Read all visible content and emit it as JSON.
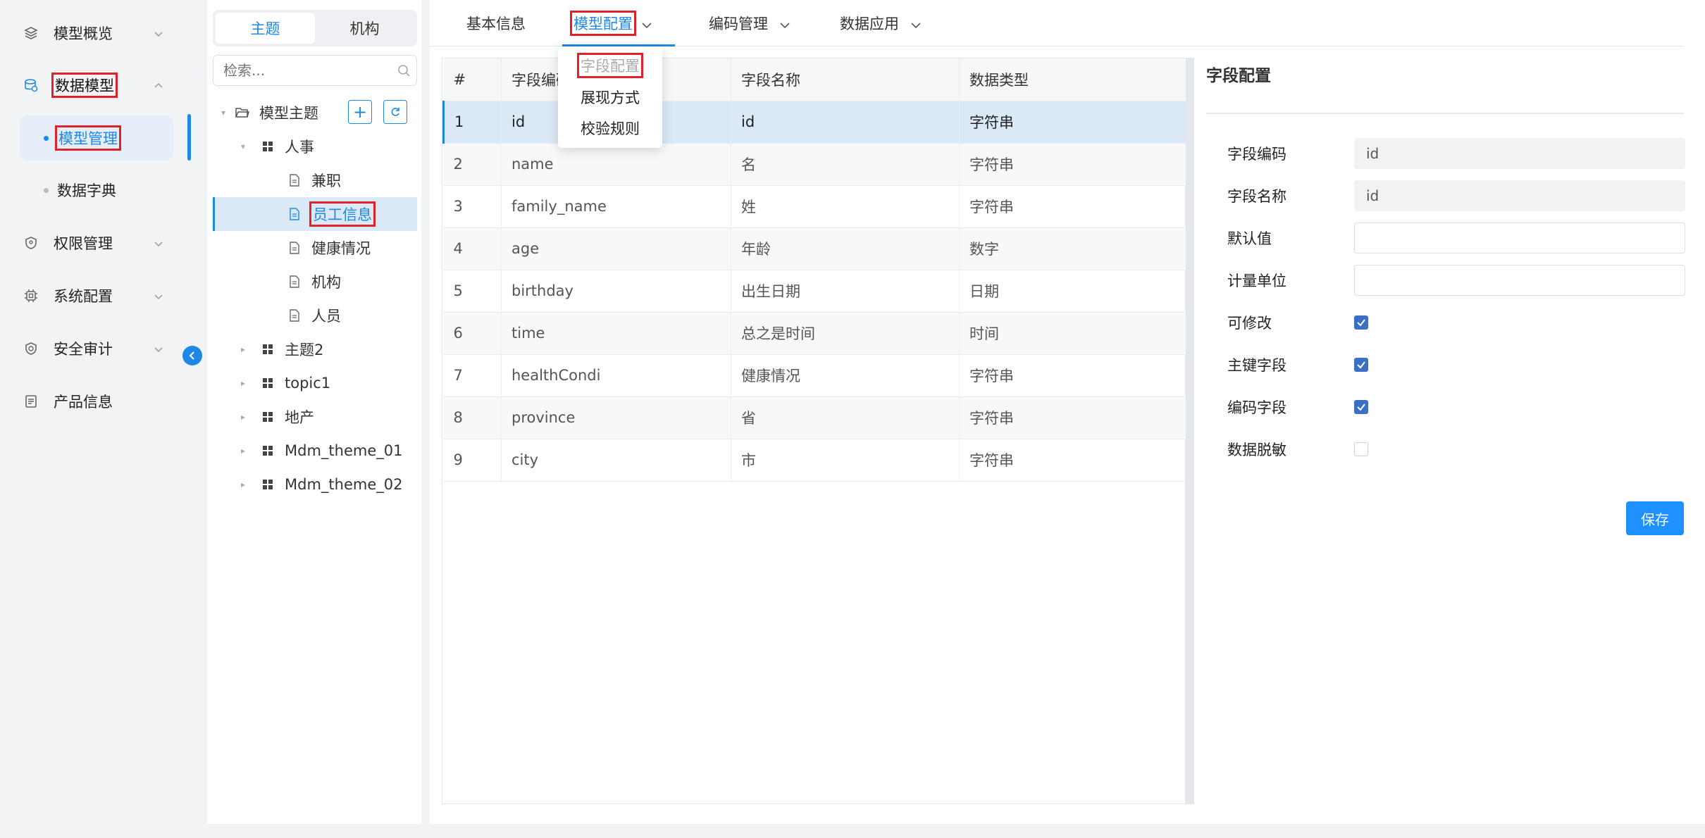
{
  "nav": {
    "items": [
      {
        "label": "模型概览",
        "icon": "layers-icon"
      },
      {
        "label": "数据模型",
        "icon": "database-icon"
      },
      {
        "label": "权限管理",
        "icon": "shield-icon"
      },
      {
        "label": "系统配置",
        "icon": "chip-icon"
      },
      {
        "label": "安全审计",
        "icon": "audit-shield-icon"
      },
      {
        "label": "产品信息",
        "icon": "document-list-icon"
      }
    ],
    "sub": [
      {
        "label": "模型管理"
      },
      {
        "label": "数据字典"
      }
    ]
  },
  "tree": {
    "segments": [
      "主题",
      "机构"
    ],
    "search_placeholder": "检索...",
    "root": "模型主题",
    "nodes": [
      "人事",
      "兼职",
      "员工信息",
      "健康情况",
      "机构",
      "人员",
      "主题2",
      "topic1",
      "地产",
      "Mdm_theme_01",
      "Mdm_theme_02"
    ]
  },
  "tabs": [
    "基本信息",
    "模型配置",
    "编码管理",
    "数据应用"
  ],
  "dropdown": [
    "字段配置",
    "展现方式",
    "校验规则"
  ],
  "table": {
    "headers": [
      "#",
      "字段编码",
      "字段名称",
      "数据类型"
    ],
    "rows": [
      [
        "1",
        "id",
        "id",
        "字符串"
      ],
      [
        "2",
        "name",
        "名",
        "字符串"
      ],
      [
        "3",
        "family_name",
        "姓",
        "字符串"
      ],
      [
        "4",
        "age",
        "年龄",
        "数字"
      ],
      [
        "5",
        "birthday",
        "出生日期",
        "日期"
      ],
      [
        "6",
        "time",
        "总之是时间",
        "时间"
      ],
      [
        "7",
        "healthCondi",
        "健康情况",
        "字符串"
      ],
      [
        "8",
        "province",
        "省",
        "字符串"
      ],
      [
        "9",
        "city",
        "市",
        "字符串"
      ]
    ]
  },
  "form": {
    "title": "字段配置",
    "code_label": "字段编码",
    "code_value": "id",
    "name_label": "字段名称",
    "name_value": "id",
    "default_label": "默认值",
    "unit_label": "计量单位",
    "editable_label": "可修改",
    "pk_label": "主键字段",
    "codefield_label": "编码字段",
    "mask_label": "数据脱敏",
    "save_label": "保存"
  }
}
